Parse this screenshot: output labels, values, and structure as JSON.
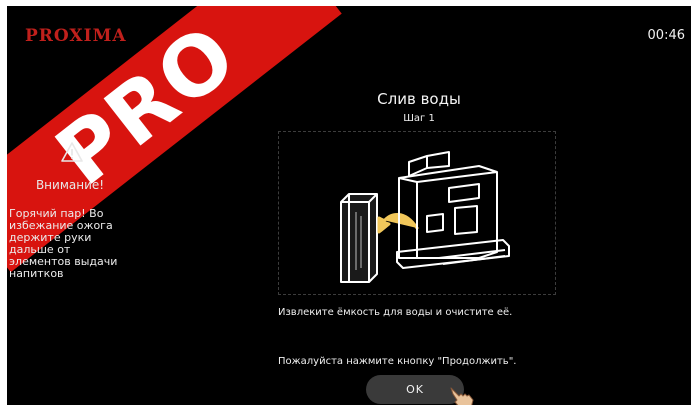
{
  "watermark": {
    "text": "PRO"
  },
  "header": {
    "brand": "PROXIMA",
    "clock": "00:46"
  },
  "warning": {
    "icon": "warning-triangle-icon",
    "title": "Внимание!",
    "lines": [
      "Горячий пар! Во",
      "избежание ожога",
      "держите руки",
      "дальше от",
      "элементов выдачи",
      "напитков"
    ]
  },
  "main": {
    "title": "Слив воды",
    "step": "Шаг 1",
    "illustration": "coffee-machine-remove-water-tank-illustration",
    "instruction": "Извлеките ёмкость для воды и очистите её.",
    "prompt": "Пожалуйста нажмите кнопку \"Продолжить\".",
    "ok_label": "OK"
  },
  "colors": {
    "banner": "#d8140f",
    "brand": "#c0201c",
    "background": "#000000",
    "button": "#3a3a3a",
    "arrow": "#f1c75a"
  }
}
